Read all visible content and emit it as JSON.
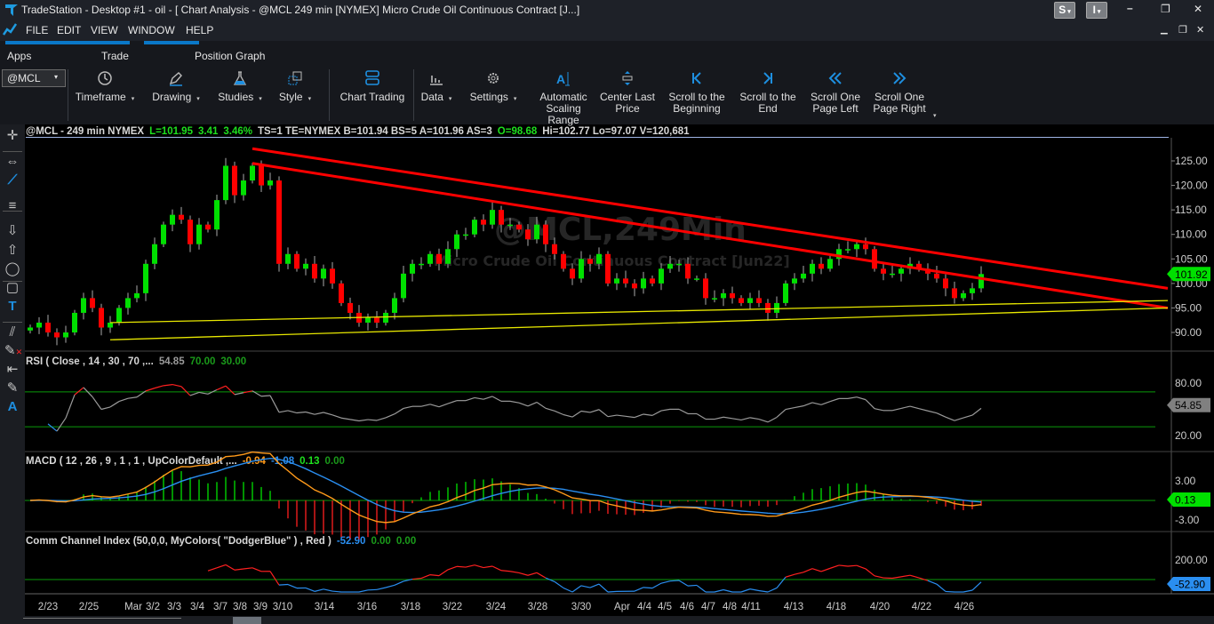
{
  "window": {
    "app": "TradeStation",
    "title": "TradeStation  - Desktop #1 - oil - [ Chart Analysis - @MCL 249 min [NYMEX] Micro Crude Oil Continuous Contract [J...]",
    "btn_s": "S",
    "btn_i": "I"
  },
  "menu": [
    "FILE",
    "EDIT",
    "VIEW",
    "WINDOW",
    "HELP"
  ],
  "tabs": [
    "Apps",
    "Trade",
    "Position Graph"
  ],
  "symbol_box": {
    "value": "@MCL"
  },
  "toolbar": [
    {
      "label": "Timeframe",
      "icon": "clock-icon",
      "dropdown": true
    },
    {
      "label": "Drawing",
      "icon": "pen-icon",
      "dropdown": true
    },
    {
      "label": "Studies",
      "icon": "flask-icon",
      "dropdown": true
    },
    {
      "label": "Style",
      "icon": "style-icon",
      "dropdown": true
    },
    {
      "label": "Chart Trading",
      "icon": "chart-trading-icon",
      "dropdown": false
    },
    {
      "label": "Data",
      "icon": "bars-icon",
      "dropdown": true
    },
    {
      "label": "Settings",
      "icon": "gear-icon",
      "dropdown": true
    },
    {
      "label": "Automatic Scaling Range",
      "icon": "auto-scale-icon",
      "dropdown": false
    },
    {
      "label": "Center Last Price",
      "icon": "center-icon",
      "dropdown": false
    },
    {
      "label": "Scroll to the Beginning",
      "icon": "scroll-begin-icon",
      "dropdown": false
    },
    {
      "label": "Scroll to the End",
      "icon": "scroll-end-icon",
      "dropdown": false
    },
    {
      "label": "Scroll One Page Left",
      "icon": "page-left-icon",
      "dropdown": false
    },
    {
      "label": "Scroll One Page Right",
      "icon": "page-right-icon",
      "dropdown": false
    }
  ],
  "left_tools": [
    "crosshair-icon",
    "horizontal-arrows-icon",
    "trendline-icon",
    "horizontal-lines-icon",
    "arrow-down-icon",
    "arrow-up-icon",
    "ellipse-icon",
    "rectangle-icon",
    "text-icon",
    "parallel-lines-icon",
    "remove-drawings-icon",
    "snap-left-icon",
    "drawing-object-icon",
    "auto-scale-icon"
  ],
  "chart_header": {
    "symbol": "@MCL - 249 min  NYMEX",
    "last": "L=101.95",
    "chg": "3.41",
    "pct": "3.46%",
    "rest": "TS=1  TE=NYMEX  B=101.94  BS=5   A=101.96  AS=3",
    "open": "O=98.68",
    "tail": "Hi=102.77  Lo=97.07  V=120,681"
  },
  "watermark": {
    "line1": "@MCL,249Min",
    "line2": "Micro Crude Oil Continuous Contract [Jun22]"
  },
  "colors": {
    "up": "#00e000",
    "down": "#ff0000",
    "trend": "#ff0000",
    "support": "#e8e800",
    "accent": "#0a78c8",
    "last_price": "#00e000"
  },
  "chart_data": {
    "type": "candlestick",
    "price_ticks": [
      "125.00",
      "120.00",
      "115.00",
      "110.00",
      "105.00",
      "100.00",
      "95.00",
      "90.00"
    ],
    "last_price": "101.92",
    "closes": [
      91,
      92,
      90,
      89,
      90,
      94,
      97,
      95,
      91,
      92,
      95,
      97,
      98,
      104,
      108,
      112,
      114,
      113,
      108,
      112,
      111,
      117,
      124,
      118,
      121,
      124,
      120,
      121,
      104,
      106,
      103,
      104,
      101,
      103,
      100,
      96,
      94,
      92,
      93,
      92,
      94,
      97,
      102,
      104,
      104,
      106,
      104,
      107,
      110,
      110,
      113,
      112,
      115,
      112,
      112,
      111,
      109,
      112,
      108,
      106,
      103,
      101,
      105,
      104,
      106,
      100,
      101,
      100,
      99,
      101,
      100,
      103,
      104,
      104,
      101,
      101,
      97,
      97,
      98,
      97,
      96,
      97,
      96,
      94,
      96,
      100,
      101,
      102,
      104,
      103,
      105,
      107,
      107,
      108,
      107,
      103,
      102,
      102,
      103,
      104,
      103,
      102,
      101,
      99,
      97,
      98,
      99,
      101.92
    ],
    "trendlines": [
      {
        "color": "red",
        "from": {
          "bar": 25,
          "price": 127.5
        },
        "to": {
          "bar": 128,
          "price": 99
        }
      },
      {
        "color": "red",
        "from": {
          "bar": 25,
          "price": 124.5
        },
        "to": {
          "bar": 128,
          "price": 95
        }
      },
      {
        "color": "yellow",
        "from": {
          "bar": 9,
          "price": 88.5
        },
        "to": {
          "bar": 128,
          "price": 95
        }
      },
      {
        "color": "yellow",
        "from": {
          "bar": 9,
          "price": 92
        },
        "to": {
          "bar": 128,
          "price": 96.5
        }
      }
    ],
    "dates": [
      "2/23",
      "2/25",
      "Mar",
      "3/2",
      "3/3",
      "3/4",
      "3/7",
      "3/8",
      "3/9",
      "3/10",
      "3/14",
      "3/16",
      "3/18",
      "3/22",
      "3/24",
      "3/28",
      "3/30",
      "Apr",
      "4/4",
      "4/5",
      "4/6",
      "4/7",
      "4/8",
      "4/11",
      "4/13",
      "4/18",
      "4/20",
      "4/22",
      "4/26"
    ],
    "rsi": {
      "label": "RSI ( Close , 14 , 30 , 70 ,...",
      "value": "54.85",
      "ob": "70.00",
      "os": "30.00",
      "ticks": [
        "80.00",
        "20.00"
      ],
      "axis_value": "54.85"
    },
    "macd": {
      "label": "MACD ( 12 , 26 , 9 , 1 , 1 , UpColorDefault ,...",
      "macd": "-0.94",
      "signal": "-1.08",
      "hist": "0.13",
      "zero": "0.00",
      "ticks": [
        "3.00",
        "-3.00"
      ],
      "axis_value": "0.13"
    },
    "cci": {
      "label": "Comm Channel Index (50,0,0, MyColors( \"DodgerBlue\" ) , Red )",
      "value": "-52.90",
      "v2": "0.00",
      "v3": "0.00",
      "ticks": [
        "200.00"
      ],
      "axis_value": "-52.90"
    }
  }
}
